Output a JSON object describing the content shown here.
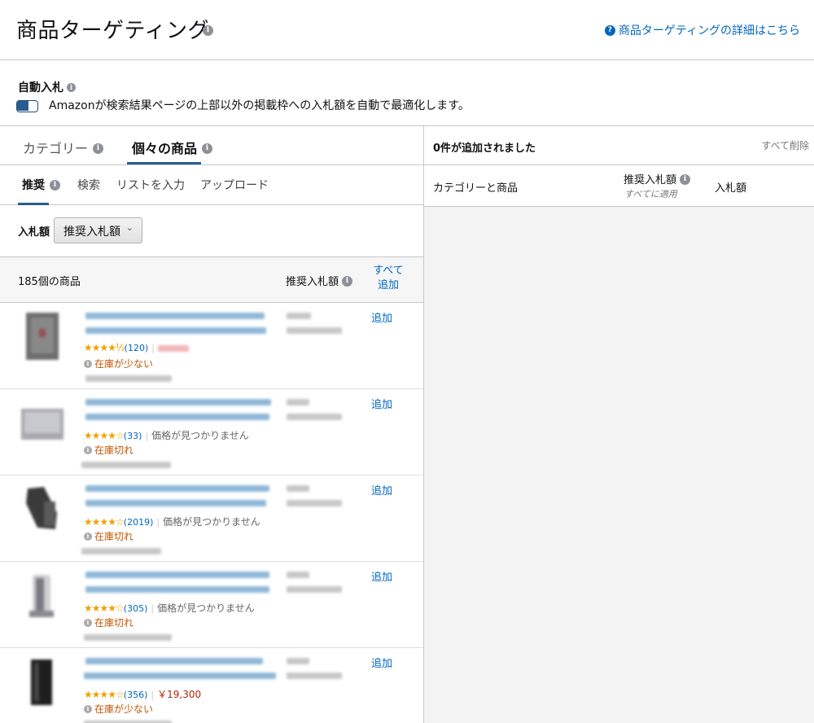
{
  "header": {
    "title": "商品ターゲティング",
    "help_link": "商品ターゲティングの詳細はこちら"
  },
  "autobid": {
    "title": "自動入札",
    "enabled": true,
    "description": "Amazonが検索結果ページの上部以外の掲載枠への入札額を自動で最適化します。"
  },
  "main_tabs": [
    {
      "label": "カテゴリー",
      "active": false
    },
    {
      "label": "個々の商品",
      "active": true
    }
  ],
  "sub_tabs": [
    {
      "label": "推奨",
      "active": true
    },
    {
      "label": "検索",
      "active": false
    },
    {
      "label": "リストを入力",
      "active": false
    },
    {
      "label": "アップロード",
      "active": false
    }
  ],
  "bid": {
    "label": "入札額",
    "selected": "推奨入札額"
  },
  "list": {
    "count_label": "185個の商品",
    "bid_column": "推奨入札額",
    "add_all_line1": "すべて",
    "add_all_line2": "追加"
  },
  "products": [
    {
      "stars": "★★★★½",
      "rating_count": "(120)",
      "price_text": "",
      "stock": "在庫が少ない",
      "add_label": "追加"
    },
    {
      "stars": "★★★★☆",
      "rating_count": "(33)",
      "price_text": "価格が見つかりません",
      "stock": "在庫切れ",
      "add_label": "追加"
    },
    {
      "stars": "★★★★☆",
      "rating_count": "(2019)",
      "price_text": "価格が見つかりません",
      "stock": "在庫切れ",
      "add_label": "追加"
    },
    {
      "stars": "★★★★☆",
      "rating_count": "(305)",
      "price_text": "価格が見つかりません",
      "stock": "在庫切れ",
      "add_label": "追加"
    },
    {
      "stars": "★★★★☆",
      "rating_count": "(356)",
      "price_text": "￥19,300",
      "stock": "在庫が少ない",
      "add_label": "追加"
    }
  ],
  "right_panel": {
    "added_count": "0件が追加されました",
    "remove_all": "すべて削除",
    "col_category": "カテゴリーと商品",
    "col_suggested": "推奨入札額",
    "col_apply_all": "すべてに適用",
    "col_bid": "入札額"
  },
  "colors": {
    "link": "#0066c0",
    "accent": "#2a5d8f",
    "stock_warning": "#c45500",
    "price": "#b12704",
    "star": "#f0a000"
  },
  "icons": {
    "info": "info-icon",
    "help": "help-circle-icon",
    "chevron": "chevron-down-icon"
  }
}
